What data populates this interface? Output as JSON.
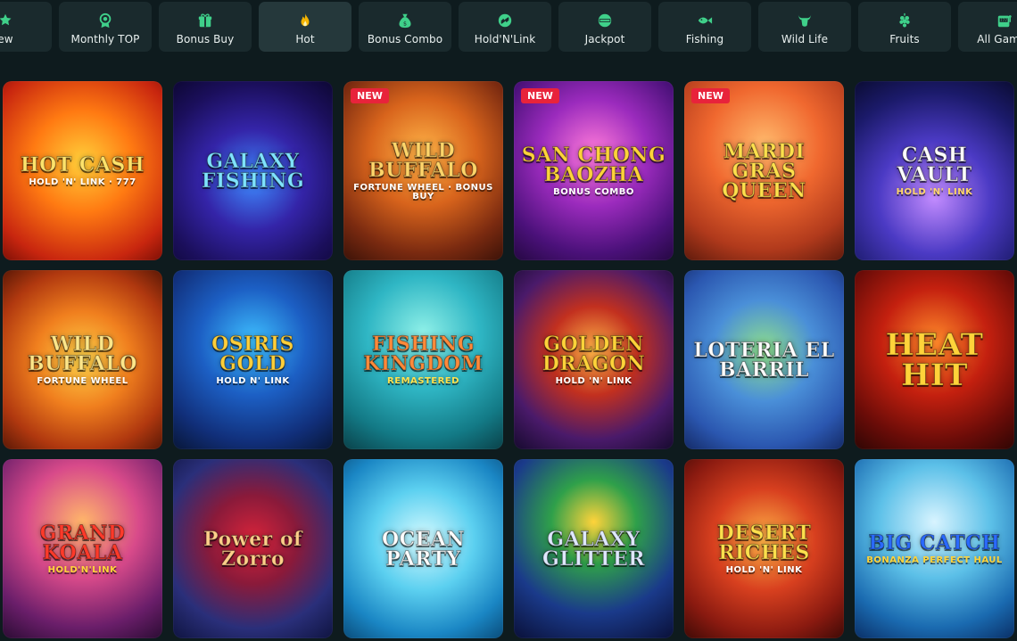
{
  "categories": [
    {
      "label": "ew",
      "icon": "new-icon"
    },
    {
      "label": "Monthly TOP",
      "icon": "medal-icon"
    },
    {
      "label": "Bonus Buy",
      "icon": "gift-icon"
    },
    {
      "label": "Hot",
      "icon": "flame-icon",
      "active": true
    },
    {
      "label": "Bonus Combo",
      "icon": "money-bag-icon"
    },
    {
      "label": "Hold'N'Link",
      "icon": "link-coin-icon"
    },
    {
      "label": "Jackpot",
      "icon": "jackpot-icon"
    },
    {
      "label": "Fishing",
      "icon": "fish-icon"
    },
    {
      "label": "Wild Life",
      "icon": "bull-icon"
    },
    {
      "label": "Fruits",
      "icon": "grapes-icon"
    },
    {
      "label": "All Games",
      "icon": "slot-machine-icon"
    }
  ],
  "games": [
    {
      "title": "Hot Cash",
      "sub": "HOLD 'N' LINK · 777",
      "badge": ""
    },
    {
      "title": "Galaxy Fishing",
      "sub": "",
      "badge": ""
    },
    {
      "title": "Wild Buffalo",
      "sub": "FORTUNE WHEEL · BONUS BUY",
      "badge": "NEW"
    },
    {
      "title": "San Chong Baozha",
      "sub": "BONUS COMBO",
      "badge": "NEW"
    },
    {
      "title": "Mardi Gras Queen",
      "sub": "",
      "badge": "NEW"
    },
    {
      "title": "Cash Vault",
      "sub": "HOLD 'N' LINK",
      "badge": ""
    },
    {
      "title": "Wild Buffalo",
      "sub": "FORTUNE WHEEL",
      "badge": ""
    },
    {
      "title": "Osiris Gold",
      "sub": "HOLD N' LINK",
      "badge": ""
    },
    {
      "title": "Fishing Kingdom",
      "sub": "REMASTERED",
      "badge": ""
    },
    {
      "title": "Golden Dragon",
      "sub": "HOLD 'N' LINK",
      "badge": ""
    },
    {
      "title": "Loteria El Barril",
      "sub": "",
      "badge": ""
    },
    {
      "title": "Heat Hit",
      "sub": "",
      "badge": ""
    },
    {
      "title": "Grand Koala",
      "sub": "HOLD'N'LINK",
      "badge": ""
    },
    {
      "title": "Power of Zorro",
      "sub": "",
      "badge": ""
    },
    {
      "title": "Ocean Party",
      "sub": "",
      "badge": ""
    },
    {
      "title": "Galaxy Glitter",
      "sub": "",
      "badge": ""
    },
    {
      "title": "Desert Riches",
      "sub": "HOLD 'N' LINK",
      "badge": ""
    },
    {
      "title": "Big Catch",
      "sub": "BONANZA PERFECT HAUL",
      "badge": ""
    }
  ],
  "colors": {
    "background": "#0e1b1e",
    "tab": "#1a2a2d",
    "tab_active": "#25383b",
    "accent_icon": "#3fd08a",
    "badge": "#e8233b"
  }
}
